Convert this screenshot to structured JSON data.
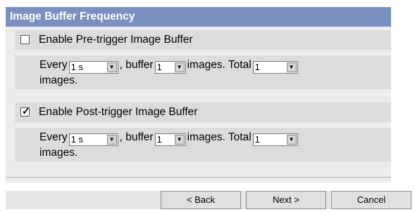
{
  "header": {
    "title": "Image Buffer Frequency"
  },
  "pre": {
    "checkbox_label": "Enable Pre-trigger Image Buffer",
    "checked": false,
    "every_label": "Every",
    "every_value": "1 s",
    "buffer_label": ", buffer",
    "buffer_value": "1",
    "images_total_label": "images. Total",
    "total_value": "1",
    "images_label": "images."
  },
  "post": {
    "checkbox_label": "Enable Post-trigger Image Buffer",
    "checked": true,
    "check_mark": "✓",
    "every_label": "Every",
    "every_value": "1 s",
    "buffer_label": ", buffer",
    "buffer_value": "1",
    "images_total_label": "images. Total",
    "total_value": "1",
    "images_label": "images."
  },
  "buttons": {
    "back": "< Back",
    "next": "Next >",
    "cancel": "Cancel"
  },
  "colors": {
    "header_bg": "#7a90c0",
    "row_bg": "#dcdcdc",
    "panel_bg": "#ececec"
  }
}
